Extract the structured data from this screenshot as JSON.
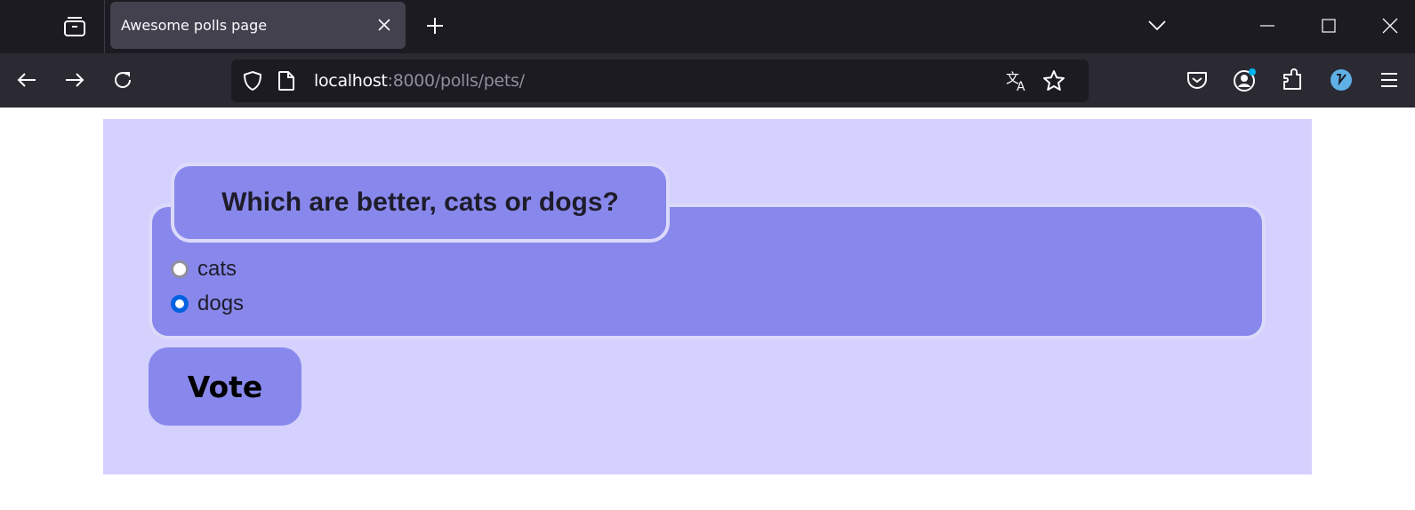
{
  "browser": {
    "tab": {
      "title": "Awesome polls page"
    },
    "url": {
      "host": "localhost",
      "rest": ":8000/polls/pets/"
    },
    "icons": {
      "tab_list": "firefox-view-icon",
      "tab_close": "close-icon",
      "new_tab": "plus-icon",
      "list_all_tabs": "chevron-down-icon",
      "minimize": "minimize-icon",
      "maximize": "maximize-icon",
      "window_close": "close-icon",
      "back": "arrow-left-icon",
      "forward": "arrow-right-icon",
      "reload": "reload-icon",
      "tracking": "shield-icon",
      "page_info": "page-icon",
      "translate": "translate-icon",
      "bookmark": "star-icon",
      "pocket": "pocket-icon",
      "account": "account-icon",
      "extensions": "puzzle-icon",
      "extension_v": "extension-icon",
      "menu": "hamburger-icon"
    },
    "colors": {
      "tabstrip_bg": "#1c1b22",
      "navbar_bg": "#2b2a33",
      "active_tab_bg": "#42414d",
      "notification_dot": "#00b3f4"
    }
  },
  "poll": {
    "question": "Which are better, cats or dogs?",
    "choices": [
      {
        "label": "cats",
        "selected": false
      },
      {
        "label": "dogs",
        "selected": true
      }
    ],
    "vote_label": "Vote",
    "colors": {
      "page_bg": "#d4d1fe",
      "fieldset_bg": "#8888ec",
      "border": "#dcdafb",
      "radio_selected": "#0061e0"
    }
  }
}
